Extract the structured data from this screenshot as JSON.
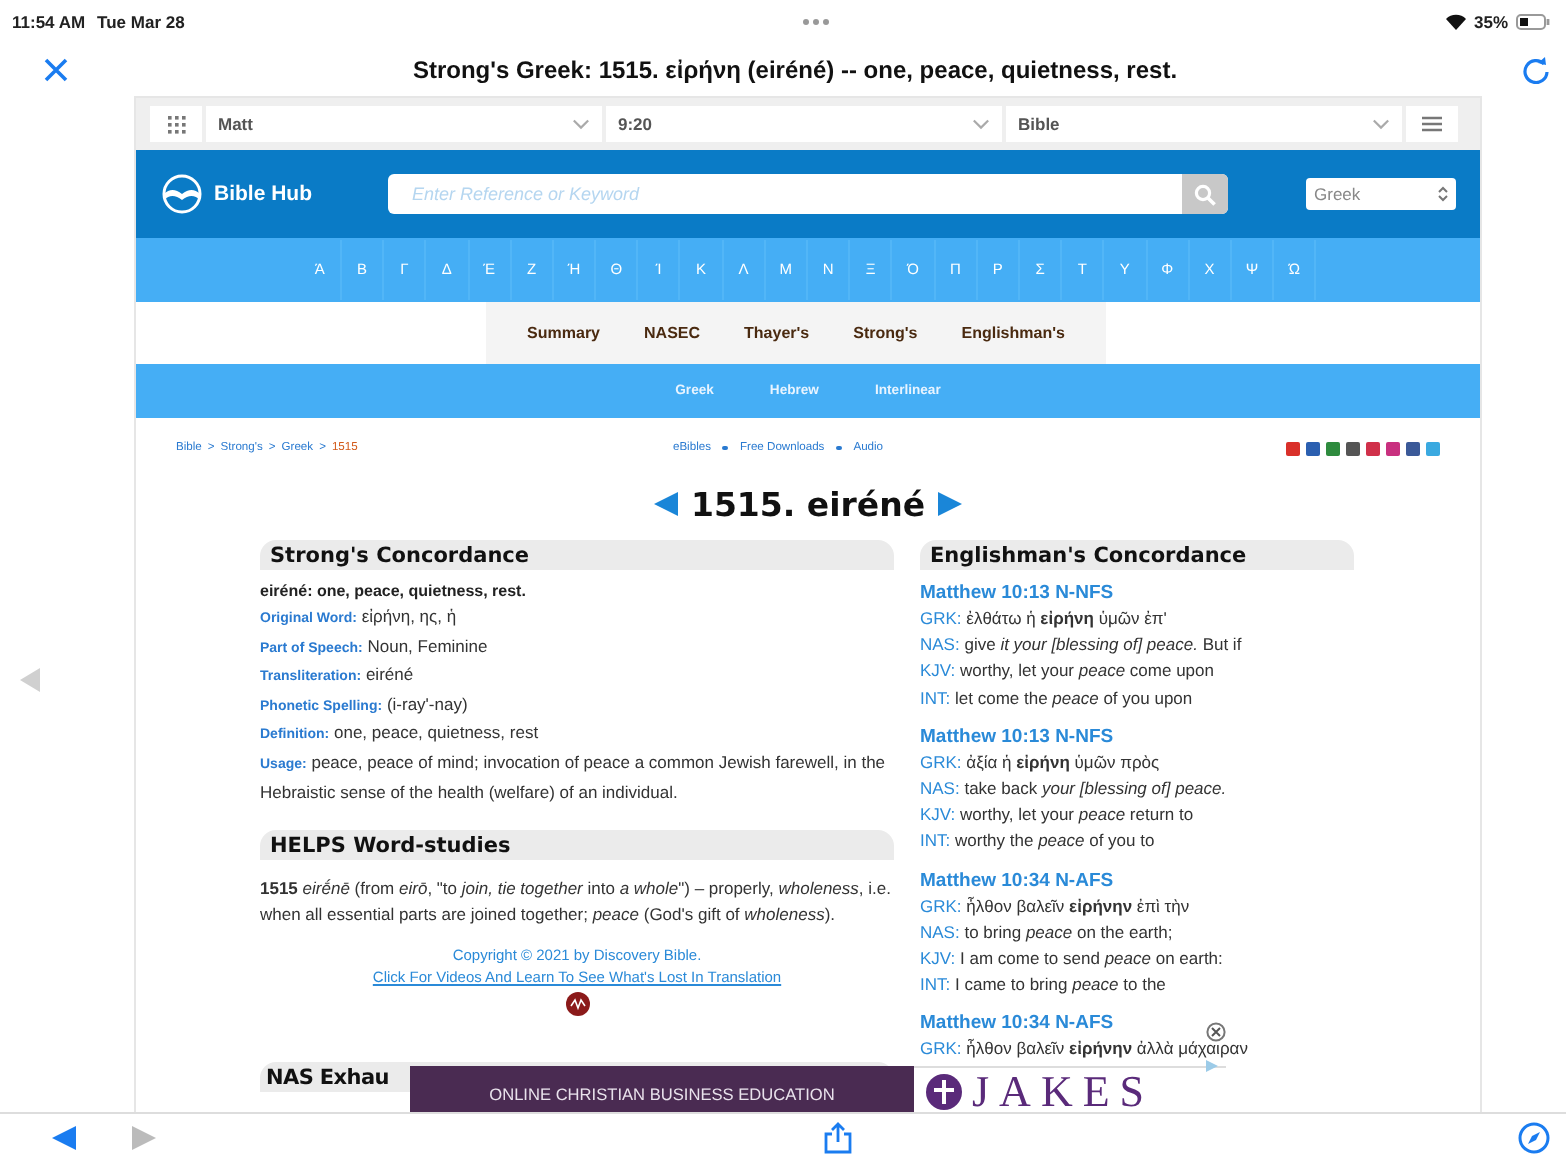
{
  "status_bar": {
    "time": "11:54 AM",
    "date": "Tue Mar 28",
    "battery": "35%"
  },
  "title_bar": {
    "title": "Strong's Greek: 1515. εἰρήνη (eiréné) -- one, peace, quietness, rest."
  },
  "toolbar": {
    "book": "Matt",
    "chapter": "9:20",
    "version": "Bible"
  },
  "header": {
    "site": "Bible Hub",
    "search_placeholder": "Enter Reference or Keyword",
    "language": "Greek"
  },
  "letters": [
    "Ά",
    "Β",
    "Γ",
    "Δ",
    "Έ",
    "Ζ",
    "Ή",
    "Θ",
    "Ί",
    "Κ",
    "Λ",
    "Μ",
    "Ν",
    "Ξ",
    "Ό",
    "Π",
    "Ρ",
    "Σ",
    "Τ",
    "Υ",
    "Φ",
    "Χ",
    "Ψ",
    "Ώ"
  ],
  "tabs": [
    "Summary",
    "NASEC",
    "Thayer's",
    "Strong's",
    "Englishman's"
  ],
  "subtabs": [
    "Greek",
    "Hebrew",
    "Interlinear"
  ],
  "breadcrumb": {
    "separator": ">",
    "items": [
      {
        "label": "Bible",
        "kind": "link"
      },
      {
        "label": "Strong's",
        "kind": "link"
      },
      {
        "label": "Greek",
        "kind": "link"
      },
      {
        "label": "1515",
        "kind": "current"
      }
    ]
  },
  "resources": [
    "eBibles",
    "Free Downloads",
    "Audio"
  ],
  "entry_title": "1515. eiréné",
  "strongs": {
    "heading": "Strong's Concordance",
    "gloss": "eiréné: one, peace, quietness, rest.",
    "fields": [
      {
        "label": "Original Word:",
        "value": "εἰρήνη, ης, ἡ"
      },
      {
        "label": "Part of Speech:",
        "value": "Noun, Feminine"
      },
      {
        "label": "Transliteration:",
        "value": "eiréné"
      },
      {
        "label": "Phonetic Spelling:",
        "value": "(i-ray'-nay)"
      },
      {
        "label": "Definition:",
        "value": "one, peace, quietness, rest"
      },
      {
        "label": "Usage:",
        "value": "peace, peace of mind; invocation of peace a common Jewish farewell, in the Hebraistic sense of the health (welfare) of an individual."
      }
    ]
  },
  "helps": {
    "heading": "HELPS Word-studies",
    "text": "**1515** *eirḗnē* (from *eirō*, \"to *join, tie together* into *a whole*\") – properly, *wholeness*, i.e. when all essential parts are joined together; *peace* (God's gift of *wholeness*).",
    "copyright": "Copyright © 2021 by Discovery Bible.",
    "link": "Click For Videos And Learn To See What's Lost In Translation"
  },
  "nas_heading": "NAS Exhau",
  "englishmans": {
    "heading": "Englishman's Concordance",
    "entries": [
      {
        "ref": "Matthew 10:13 N-NFS",
        "lines": [
          {
            "label": "GRK:",
            "text": "ἐλθάτω ἡ **εἰρήνη** ὑμῶν ἐπ'"
          },
          {
            "label": "NAS:",
            "text": "give *it your [blessing of] peace.* But if"
          },
          {
            "label": "KJV:",
            "text": "worthy, let your *peace* come upon"
          },
          {
            "label": "INT:",
            "text": "let come the *peace* of you upon"
          }
        ]
      },
      {
        "ref": "Matthew 10:13 N-NFS",
        "lines": [
          {
            "label": "GRK:",
            "text": "ἀξία ἡ **εἰρήνη** ὑμῶν πρὸς"
          },
          {
            "label": "NAS:",
            "text": "take back *your [blessing of] peace.*"
          },
          {
            "label": "KJV:",
            "text": "worthy, let your *peace* return to"
          },
          {
            "label": "INT:",
            "text": "worthy the *peace* of you to"
          }
        ]
      },
      {
        "ref": "Matthew 10:34 N-AFS",
        "lines": [
          {
            "label": "GRK:",
            "text": "ἦλθον βαλεῖν **εἰρήνην** ἐπὶ τὴν"
          },
          {
            "label": "NAS:",
            "text": "to bring *peace* on the earth;"
          },
          {
            "label": "KJV:",
            "text": "I am come to send *peace* on earth:"
          },
          {
            "label": "INT:",
            "text": "I came to bring *peace* to the"
          }
        ]
      },
      {
        "ref": "Matthew 10:34 N-AFS",
        "lines": [
          {
            "label": "GRK:",
            "text": "ἦλθον βαλεῖν **εἰρήνην** ἀλλὰ μάχαιραν"
          }
        ]
      }
    ]
  },
  "ad": {
    "headline": "ONLINE CHRISTIAN BUSINESS EDUCATION",
    "brand": "JAKES"
  }
}
